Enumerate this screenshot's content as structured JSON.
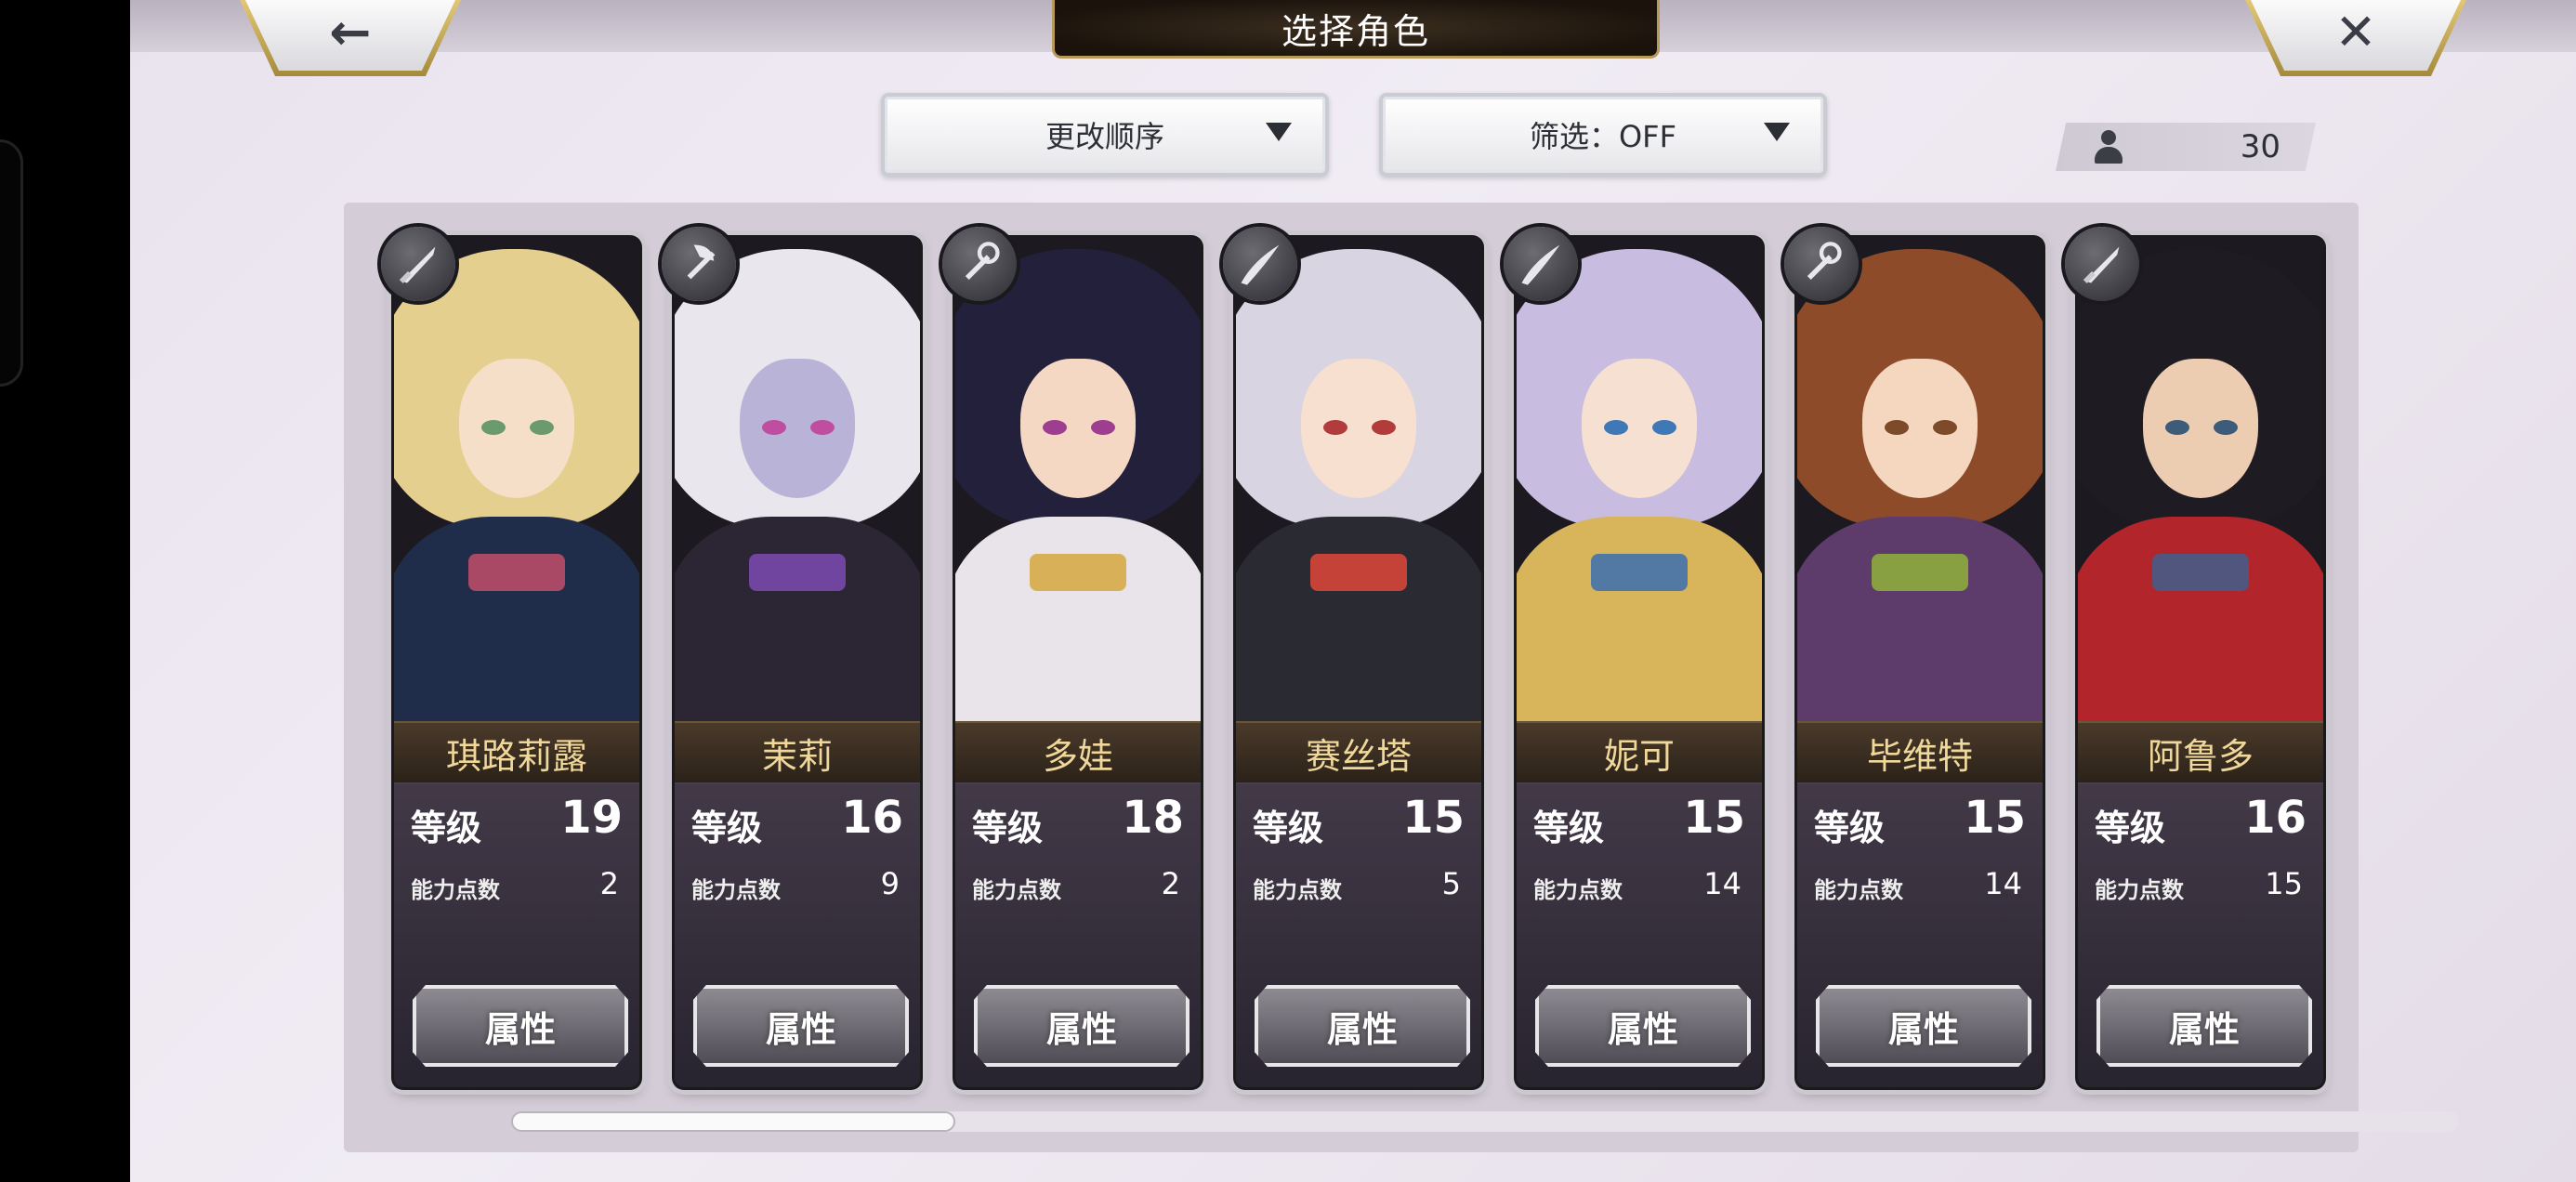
{
  "header": {
    "title": "选择角色",
    "back_icon": "back-arrow-icon",
    "close_icon": "close-icon"
  },
  "controls": {
    "sort_label": "更改顺序",
    "filter_label": "筛选：OFF",
    "character_count": "30"
  },
  "characters": [
    {
      "name": "琪路莉露",
      "level_label": "等级",
      "level": "19",
      "points_label": "能力点数",
      "points": "2",
      "button": "属性",
      "class_icon": "sword-icon",
      "hair": "#e4cf8e",
      "skin": "#f6dfc9",
      "outfit": "#1f2c4a",
      "accent": "#c24f6a",
      "eye": "#6b9a6e"
    },
    {
      "name": "茉莉",
      "level_label": "等级",
      "level": "16",
      "points_label": "能力点数",
      "points": "9",
      "button": "属性",
      "class_icon": "axe-icon",
      "hair": "#e9e6ee",
      "skin": "#b9b3d8",
      "outfit": "#2c2533",
      "accent": "#7d4bb3",
      "eye": "#c04ea0"
    },
    {
      "name": "多娃",
      "level_label": "等级",
      "level": "18",
      "points_label": "能力点数",
      "points": "2",
      "button": "属性",
      "class_icon": "staff-icon",
      "hair": "#23203c",
      "skin": "#f4d8c4",
      "outfit": "#e9e4ea",
      "accent": "#d4a73d",
      "eye": "#9d3e8f"
    },
    {
      "name": "赛丝塔",
      "level_label": "等级",
      "level": "15",
      "points_label": "能力点数",
      "points": "5",
      "button": "属性",
      "class_icon": "blade-icon",
      "hair": "#d9d4e2",
      "skin": "#f7e0cf",
      "outfit": "#2a2a33",
      "accent": "#e0473a",
      "eye": "#b23c3c"
    },
    {
      "name": "妮可",
      "level_label": "等级",
      "level": "15",
      "points_label": "能力点数",
      "points": "14",
      "button": "属性",
      "class_icon": "blade-icon",
      "hair": "#c8bde0",
      "skin": "#f6e0d2",
      "outfit": "#d8b45a",
      "accent": "#3a6fb0",
      "eye": "#3f78b6"
    },
    {
      "name": "毕维特",
      "level_label": "等级",
      "level": "15",
      "points_label": "能力点数",
      "points": "14",
      "button": "属性",
      "class_icon": "staff-icon",
      "hair": "#8d4b2a",
      "skin": "#f5d7bf",
      "outfit": "#5d3b6b",
      "accent": "#8fb33a",
      "eye": "#7d4a2a"
    },
    {
      "name": "阿鲁多",
      "level_label": "等级",
      "level": "16",
      "points_label": "能力点数",
      "points": "15",
      "button": "属性",
      "class_icon": "sword-icon",
      "hair": "#1e1c22",
      "skin": "#eccdb2",
      "outfit": "#b2252a",
      "accent": "#3e5f8c",
      "eye": "#3c5c7a"
    }
  ],
  "colors": {
    "name_text": "#f0d79a",
    "panel": "#d4ccd6",
    "title_plate": "#1a120b"
  },
  "scroll": {
    "position": 0.0
  }
}
